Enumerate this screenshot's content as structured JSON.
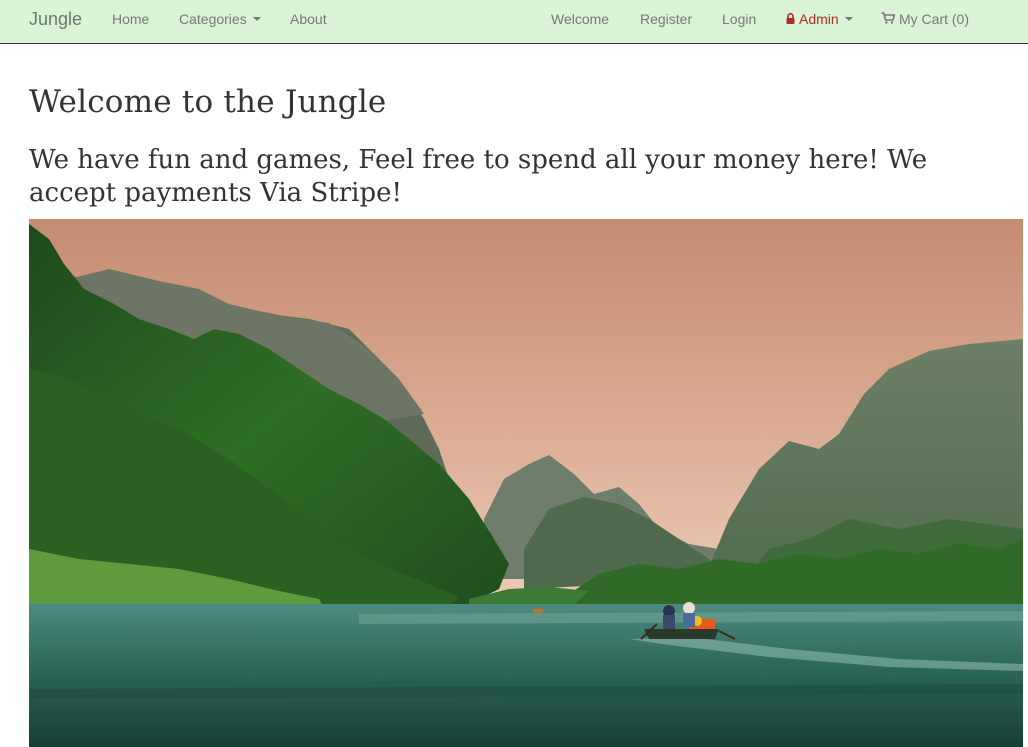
{
  "nav": {
    "brand": "Jungle",
    "home": "Home",
    "categories": "Categories",
    "about": "About",
    "welcome": "Welcome",
    "register": "Register",
    "login": "Login",
    "admin": "Admin",
    "cart": "My Cart (0)"
  },
  "main": {
    "title": "Welcome to the Jungle",
    "subtitle": "We have fun and games, Feel free to spend all your money here! We accept payments Via Stripe!"
  },
  "colors": {
    "navbar_bg": "#d9f5d5",
    "admin_red": "#b22a2a"
  },
  "icons": {
    "admin": "lock-icon",
    "cart": "shopping-cart-icon"
  }
}
